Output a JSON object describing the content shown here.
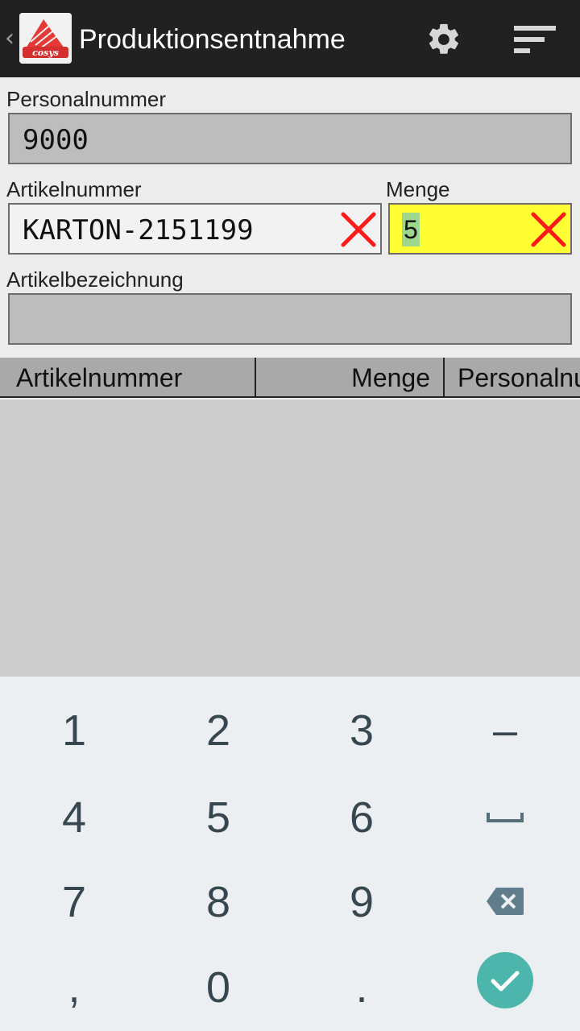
{
  "header": {
    "title": "Produktionsentnahme",
    "back_glyph": "‹",
    "icons": {
      "back": "chevron-left-icon",
      "logo": "app-logo",
      "settings": "gear-icon",
      "menu": "sort-menu-icon"
    }
  },
  "form": {
    "personalnummer": {
      "label": "Personalnummer",
      "value": "9000"
    },
    "artikelnummer": {
      "label": "Artikelnummer",
      "value": "KARTON-2151199"
    },
    "menge": {
      "label": "Menge",
      "value": "5"
    },
    "artikelbezeichnung": {
      "label": "Artikelbezeichnung",
      "value": ""
    }
  },
  "table": {
    "columns": [
      "Artikelnummer",
      "Menge",
      "Personalnummer"
    ],
    "rows": []
  },
  "keyboard": {
    "keys": [
      "1",
      "2",
      "3",
      "–",
      "4",
      "5",
      "6",
      "space",
      "7",
      "8",
      "9",
      "backspace",
      ",",
      "0",
      ".",
      "done"
    ],
    "labels": {
      "k1": "1",
      "k2": "2",
      "k3": "3",
      "dash": "–",
      "k4": "4",
      "k5": "5",
      "k6": "6",
      "k7": "7",
      "k8": "8",
      "k9": "9",
      "comma": ",",
      "k0": "0",
      "period": "."
    }
  },
  "colors": {
    "actionbar": "#212121",
    "highlight_field": "#ffff33",
    "selection": "#9fd68e",
    "clear_x": "#ff1a1a",
    "done_button": "#4db6ac"
  }
}
